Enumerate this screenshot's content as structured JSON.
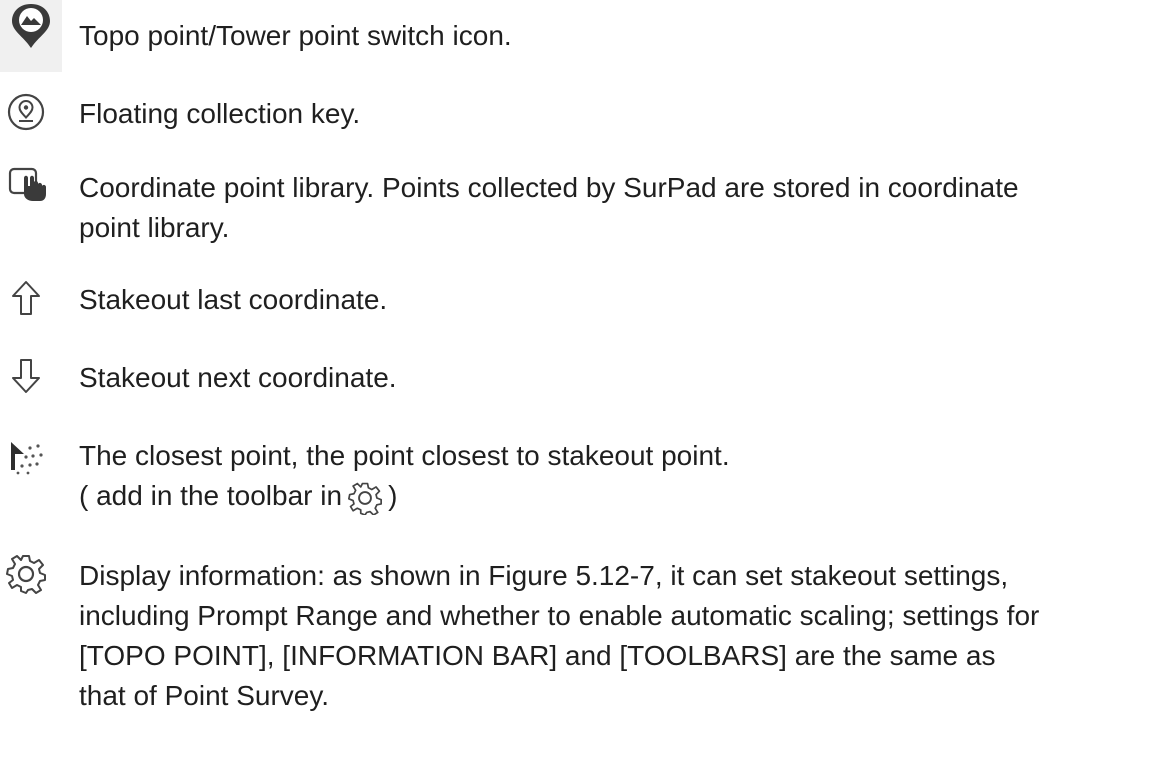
{
  "items": [
    {
      "icon": "map-marker-mountain-icon",
      "lines": [
        "Topo point/Tower point switch icon."
      ]
    },
    {
      "icon": "location-pin-icon",
      "lines": [
        "Floating collection key."
      ]
    },
    {
      "icon": "hand-pointer-tablet-icon",
      "lines": [
        "Coordinate point library. Points collected by SurPad are stored in coordinate",
        "point library."
      ]
    },
    {
      "icon": "arrow-up-outline-icon",
      "lines": [
        "Stakeout last coordinate."
      ]
    },
    {
      "icon": "arrow-down-outline-icon",
      "lines": [
        "Stakeout next coordinate."
      ]
    },
    {
      "icon": "closest-point-icon",
      "lines": [
        "The closest point, the point closest to stakeout point."
      ],
      "note_before": "( add in the toolbar in",
      "note_after": ")"
    },
    {
      "icon": "gear-icon",
      "lines": [
        "Display information: as shown in Figure 5.12-7, it can set stakeout settings,",
        "including Prompt Range and whether to enable automatic scaling; settings for",
        "[TOPO POINT], [INFORMATION BAR] and [TOOLBARS] are the same as",
        "that of Point Survey."
      ]
    }
  ]
}
